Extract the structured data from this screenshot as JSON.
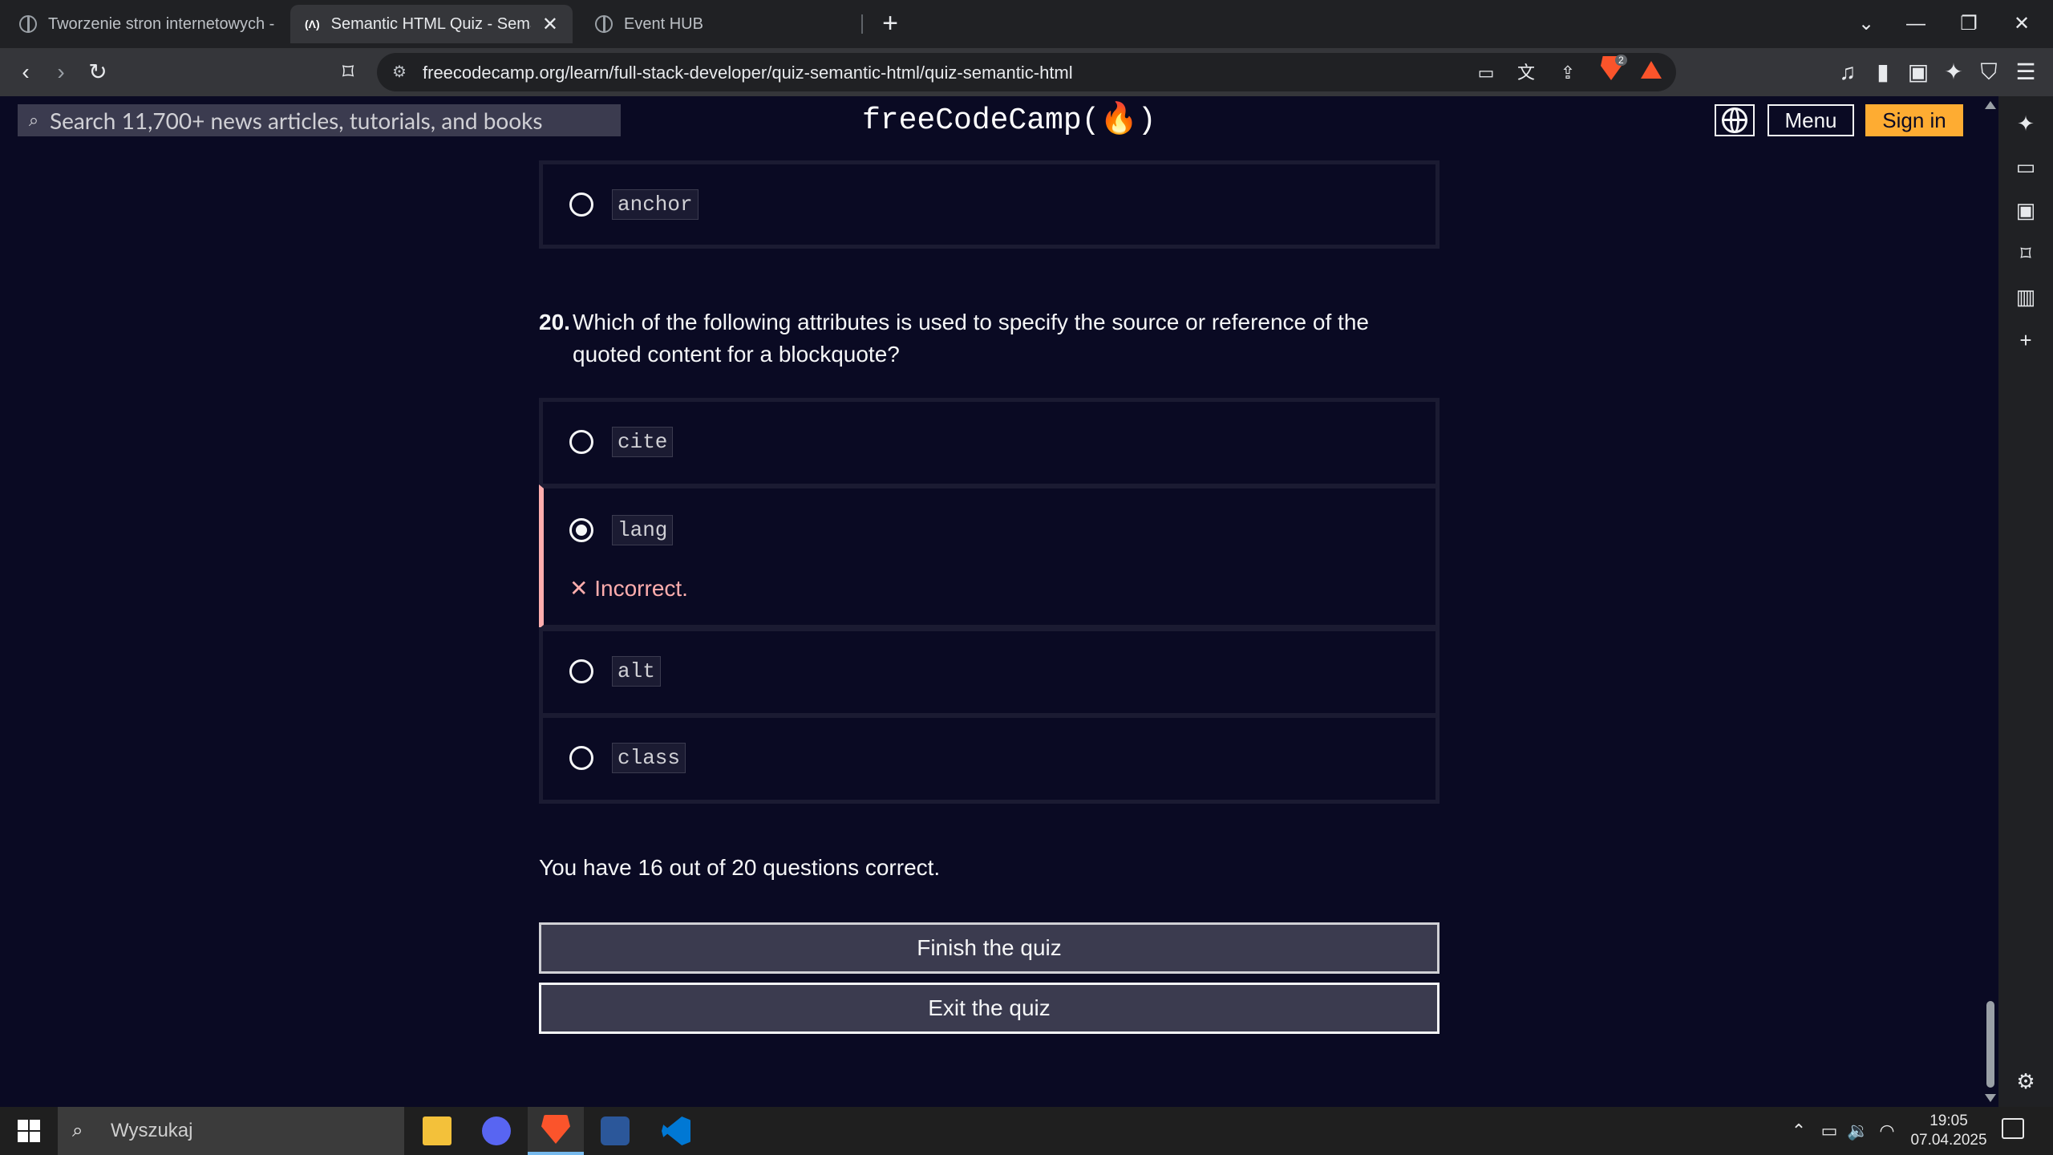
{
  "browser": {
    "tabs": [
      {
        "title": "Tworzenie stron internetowych - Un"
      },
      {
        "title": "Semantic HTML Quiz - Semanti",
        "favicon": "(Λ)"
      },
      {
        "title": "Event HUB"
      }
    ],
    "new_tab": "+",
    "address": "freecodecamp.org/learn/full-stack-developer/quiz-semantic-html/quiz-semantic-html",
    "brave_shield_count": "2"
  },
  "fcc": {
    "search_placeholder": "Search 11,700+ news articles, tutorials, and books",
    "logo": "freeCodeCamp(🔥)",
    "menu_label": "Menu",
    "signin_label": "Sign in"
  },
  "quiz": {
    "prev_option": "anchor",
    "question_number": "20.",
    "question_text": "Which of the following attributes is used to specify the source or reference of the quoted content for a blockquote?",
    "options": [
      {
        "code": "cite",
        "selected": false
      },
      {
        "code": "lang",
        "selected": true
      },
      {
        "code": "alt",
        "selected": false
      },
      {
        "code": "class",
        "selected": false
      }
    ],
    "feedback_icon": "✕",
    "feedback": "Incorrect.",
    "score": "You have 16 out of 20 questions correct.",
    "finish_label": "Finish the quiz",
    "exit_label": "Exit the quiz"
  },
  "taskbar": {
    "search_placeholder": "Wyszukaj",
    "time": "19:05",
    "date": "07.04.2025"
  },
  "colors": {
    "page_bg": "#0a0a23",
    "option_border": "#1b1b32",
    "incorrect": "#ffadad",
    "signin_bg": "#feac32",
    "button_bg": "#3b3b4f"
  }
}
